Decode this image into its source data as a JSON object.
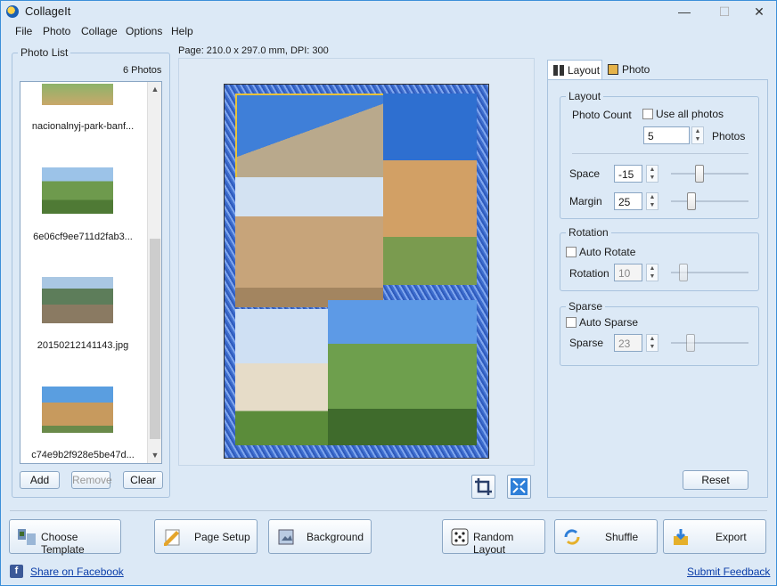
{
  "window": {
    "title": "CollageIt",
    "minimize": "—",
    "maximize": "☐",
    "close": "✕"
  },
  "menu": [
    "File",
    "Photo",
    "Collage",
    "Options",
    "Help"
  ],
  "photo_list": {
    "legend": "Photo List",
    "count": "6 Photos",
    "items": [
      {
        "caption": "nacionalnyj-park-banf..."
      },
      {
        "caption": "6e06cf9ee711d2fab3..."
      },
      {
        "caption": "20150212141143.jpg"
      },
      {
        "caption": "c74e9b2f928e5be47d..."
      }
    ],
    "add": "Add",
    "remove": "Remove",
    "clear": "Clear"
  },
  "page_info": "Page: 210.0 x 297.0 mm, DPI: 300",
  "tabs": {
    "layout": "Layout",
    "photo": "Photo"
  },
  "layout": {
    "legend": "Layout",
    "photo_count_label": "Photo Count",
    "use_all_photos": "Use all photos",
    "photo_count": "5",
    "photos_label": "Photos",
    "space_label": "Space",
    "space": "-15",
    "margin_label": "Margin",
    "margin": "25"
  },
  "rotation": {
    "legend": "Rotation",
    "auto_rotate": "Auto Rotate",
    "label": "Rotation",
    "value": "10"
  },
  "sparse": {
    "legend": "Sparse",
    "auto_sparse": "Auto Sparse",
    "label": "Sparse",
    "value": "23"
  },
  "reset": "Reset",
  "bottom": {
    "choose_template": "Choose Template",
    "page_setup": "Page Setup",
    "background": "Background",
    "random_layout": "Random Layout",
    "shuffle": "Shuffle",
    "export": "Export"
  },
  "footer": {
    "share": "Share on Facebook",
    "feedback": "Submit Feedback"
  }
}
